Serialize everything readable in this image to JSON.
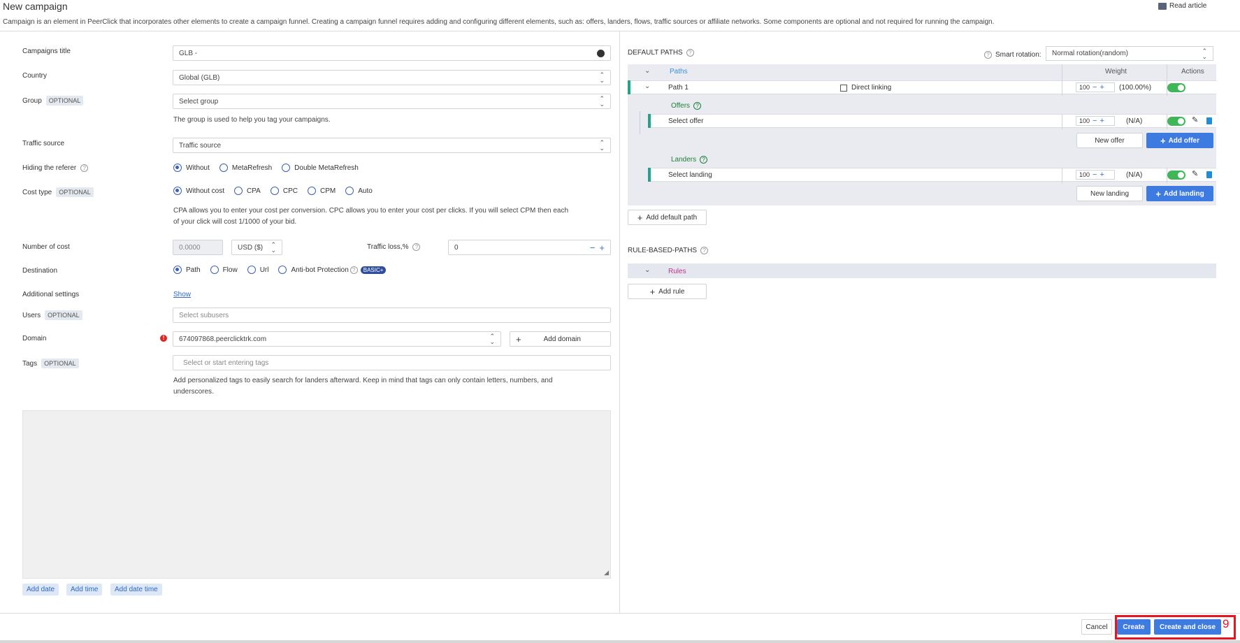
{
  "header": {
    "title": "New campaign",
    "description": "Campaign is an element in PeerClick that incorporates other elements to create a campaign funnel. Creating a campaign funnel requires adding and configuring different elements, such as: offers, landers, flows, traffic sources or affiliate networks. Some components are optional and not required for running the campaign.",
    "read_article": "Read article"
  },
  "form": {
    "campaign_title_label": "Campaigns title",
    "campaign_title_value": "GLB -",
    "country_label": "Country",
    "country_value": "Global (GLB)",
    "group_label": "Group",
    "optional": "OPTIONAL",
    "group_placeholder": "Select group",
    "group_note": "The group is used to help you tag your campaigns.",
    "traffic_source_label": "Traffic source",
    "traffic_source_value": "Traffic source",
    "hiding_referer_label": "Hiding the referer",
    "hiding_options": [
      "Without",
      "MetaRefresh",
      "Double MetaRefresh"
    ],
    "cost_type_label": "Cost type",
    "cost_options": [
      "Without cost",
      "CPA",
      "CPC",
      "CPM",
      "Auto"
    ],
    "cost_note_1": "CPA allows you to enter your cost per conversion. CPC allows you to enter your cost per clicks. If you will select CPM then each",
    "cost_note_2": "of your click will cost 1/1000 of your bid.",
    "number_of_cost_label": "Number of cost",
    "cost_value": "0.0000",
    "currency_value": "USD ($)",
    "traffic_loss_label": "Traffic loss,%",
    "traffic_loss_value": "0",
    "destination_label": "Destination",
    "destination_options": [
      "Path",
      "Flow",
      "Url",
      "Anti-bot Protection"
    ],
    "basic_badge": "BASIC+",
    "additional_settings_label": "Additional settings",
    "show_link": "Show",
    "users_label": "Users",
    "users_placeholder": "Select subusers",
    "domain_label": "Domain",
    "domain_value": "674097868.peerclicktrk.com",
    "add_domain": "Add domain",
    "tags_label": "Tags",
    "tags_placeholder": "Select or start entering tags",
    "tags_note_1": "Add personalized tags to easily search for landers afterward. Keep in mind that tags can only contain letters, numbers, and",
    "tags_note_2": "underscores.",
    "add_date": "Add date",
    "add_time": "Add time",
    "add_date_time": "Add date time"
  },
  "paths": {
    "title": "DEFAULT PATHS",
    "smart_rotation_label": "Smart rotation:",
    "smart_rotation_value": "Normal rotation(random)",
    "col_paths": "Paths",
    "col_weight": "Weight",
    "col_actions": "Actions",
    "path_name": "Path 1",
    "direct_linking": "Direct linking",
    "path_weight": "100",
    "path_percent": "(100.00%)",
    "offers_label": "Offers",
    "offer_name": "Select offer",
    "offer_weight": "100",
    "offer_percent": "(N/A)",
    "new_offer": "New offer",
    "add_offer": "Add offer",
    "landers_label": "Landers",
    "lander_name": "Select landing",
    "lander_weight": "100",
    "lander_percent": "(N/A)",
    "new_landing": "New landing",
    "add_landing": "Add landing",
    "add_default_path": "Add default path"
  },
  "rules": {
    "title": "RULE-BASED-PATHS",
    "col_rules": "Rules",
    "add_rule": "Add rule"
  },
  "footer": {
    "cancel": "Cancel",
    "create": "Create",
    "create_and_close": "Create and close",
    "marker": "9"
  },
  "colors": {
    "accent": "#3d7be0",
    "green": "#3fb657",
    "teal": "#1fa38a",
    "highlight": "#e8141f"
  }
}
